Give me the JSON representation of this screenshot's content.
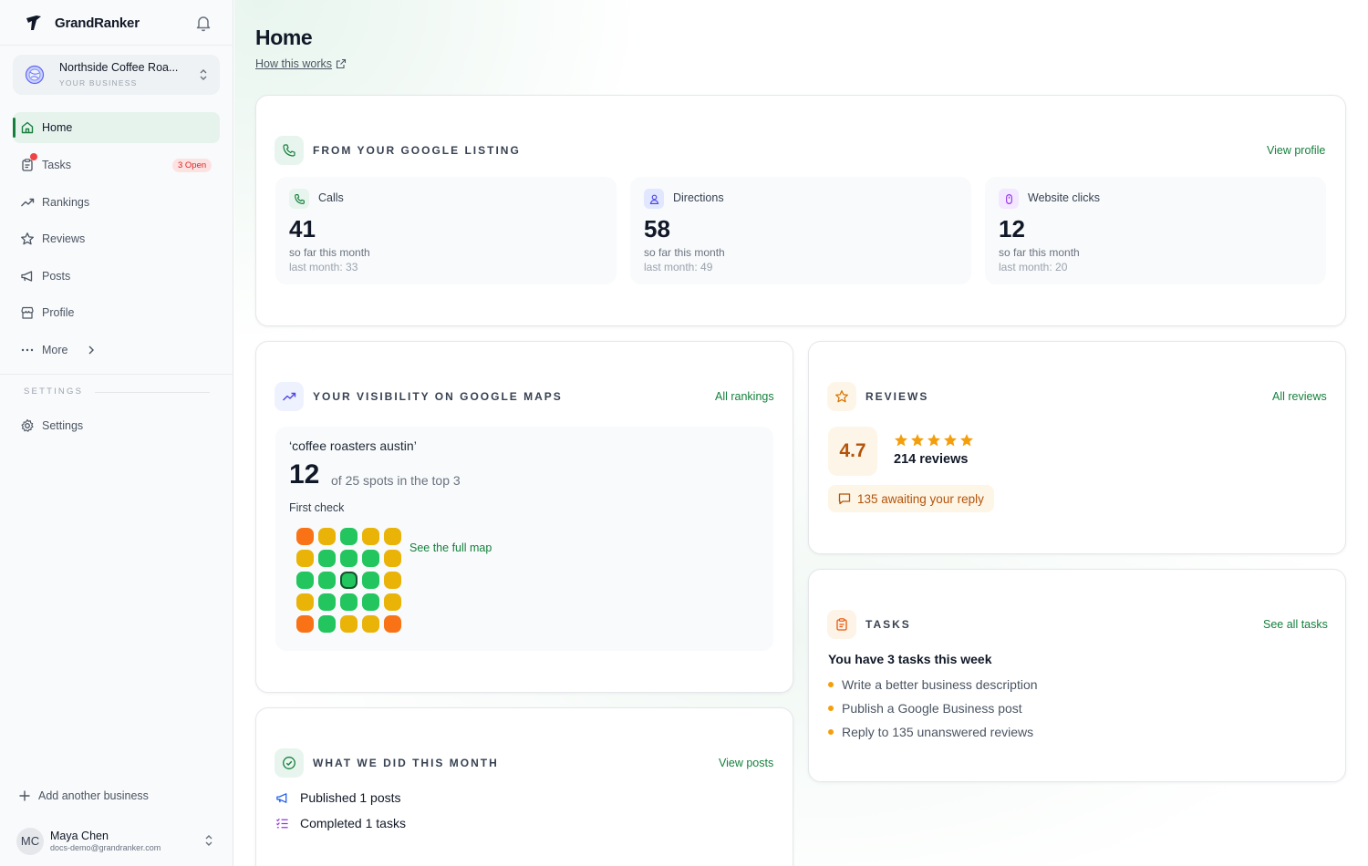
{
  "app": {
    "name": "GrandRanker"
  },
  "business": {
    "name": "Northside Coffee Roa...",
    "label": "YOUR BUSINESS"
  },
  "nav": {
    "home": "Home",
    "tasks": "Tasks",
    "tasks_badge": "3 Open",
    "rankings": "Rankings",
    "reviews": "Reviews",
    "posts": "Posts",
    "profile": "Profile",
    "more": "More",
    "settings_heading": "SETTINGS",
    "settings": "Settings",
    "add_business": "Add another business"
  },
  "user": {
    "initials": "MC",
    "name": "Maya Chen",
    "email": "docs-demo@grandranker.com"
  },
  "page": {
    "title": "Home",
    "how_link": "How this works"
  },
  "listing": {
    "title": "FROM YOUR GOOGLE LISTING",
    "link": "View profile",
    "stats": [
      {
        "label": "Calls",
        "value": "41",
        "sub": "so far this month",
        "last": "last month: 33"
      },
      {
        "label": "Directions",
        "value": "58",
        "sub": "so far this month",
        "last": "last month: 49"
      },
      {
        "label": "Website clicks",
        "value": "12",
        "sub": "so far this month",
        "last": "last month: 20"
      }
    ]
  },
  "visibility": {
    "title": "YOUR VISIBILITY ON GOOGLE MAPS",
    "link": "All rankings",
    "keyword": "‘coffee roasters austin’",
    "rank": "12",
    "of_text": "of 25 spots in the top 3",
    "first_check": "First check",
    "map_link": "See the full map",
    "grid": [
      [
        "orange",
        "yellow",
        "green",
        "yellow",
        "yellow"
      ],
      [
        "yellow",
        "green",
        "green",
        "green",
        "yellow"
      ],
      [
        "green",
        "green",
        "green",
        "green",
        "yellow"
      ],
      [
        "yellow",
        "green",
        "green",
        "green",
        "yellow"
      ],
      [
        "orange",
        "green",
        "yellow",
        "yellow",
        "orange"
      ]
    ],
    "center": [
      2,
      2
    ]
  },
  "reviews": {
    "title": "REVIEWS",
    "link": "All reviews",
    "rating": "4.7",
    "count": "214 reviews",
    "awaiting": "135 awaiting your reply"
  },
  "tasks": {
    "title": "TASKS",
    "link": "See all tasks",
    "heading": "You have 3 tasks this week",
    "items": [
      "Write a better business description",
      "Publish a Google Business post",
      "Reply to 135 unanswered reviews"
    ]
  },
  "did": {
    "title": "WHAT WE DID THIS MONTH",
    "link": "View posts",
    "posts": "Published 1 posts",
    "tasks": "Completed 1 tasks"
  },
  "colors": {
    "accent": "#15803d",
    "grid_green": "#22c55e",
    "grid_yellow": "#eab308",
    "grid_orange": "#f97316",
    "star": "#f59e0b"
  }
}
